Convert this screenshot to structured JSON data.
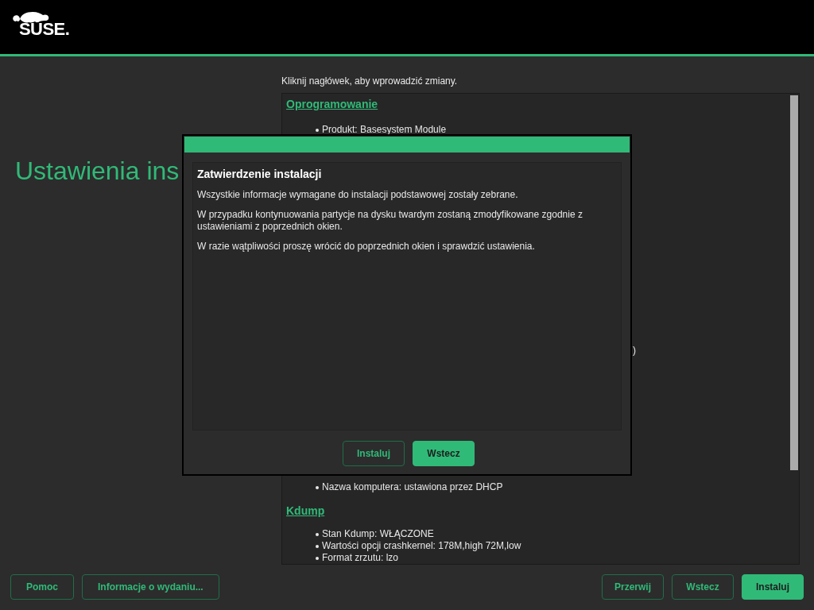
{
  "header": {
    "logo_text": "SUSE."
  },
  "page_title": "Ustawienia ins",
  "hint": "Kliknij nagłówek, aby wprowadzić zmiany.",
  "summary": {
    "top_sections": [
      {
        "heading": "Oprogramowanie",
        "items": [
          "Produkt: Basesystem Module"
        ]
      }
    ],
    "fragment": ")",
    "bottom_items": [
      "Nazwa komputera: ustawiona przez DHCP"
    ],
    "bottom_sections": [
      {
        "heading": "Kdump",
        "items": [
          "Stan Kdump: WŁĄCZONE",
          "Wartości opcji crashkernel: 178M,high 72M,low",
          "Format zrzutu: lzo"
        ]
      }
    ]
  },
  "dialog": {
    "heading": "Zatwierdzenie instalacji",
    "paragraphs": [
      "Wszystkie informacje wymagane do instalacji podstawowej zostały zebrane.",
      "W przypadku kontynuowania partycje na dysku twardym zostaną zmodyfikowane zgodnie z ustawieniami z poprzednich okien.",
      "W razie wątpliwości proszę wrócić do poprzednich okien i sprawdzić ustawienia."
    ],
    "buttons": [
      {
        "label": "Instaluj",
        "kind": "outline"
      },
      {
        "label": "Wstecz",
        "kind": "primary"
      }
    ]
  },
  "footer": {
    "left_buttons": [
      {
        "label": "Pomoc",
        "kind": "outline"
      },
      {
        "label": "Informacje o wydaniu...",
        "kind": "outline"
      }
    ],
    "right_buttons": [
      {
        "label": "Przerwij",
        "kind": "outline"
      },
      {
        "label": "Wstecz",
        "kind": "outline"
      },
      {
        "label": "Instaluj",
        "kind": "primary"
      }
    ]
  }
}
